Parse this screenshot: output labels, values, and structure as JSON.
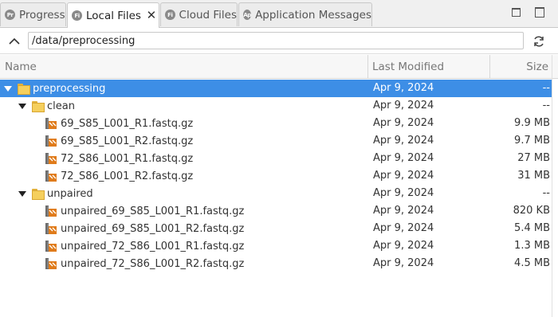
{
  "tabs": [
    {
      "label": "Progress",
      "icon": "Pr"
    },
    {
      "label": "Local Files",
      "icon": "Fi",
      "active": true
    },
    {
      "label": "Cloud Files",
      "icon": "Fi"
    },
    {
      "label": "Application Messages",
      "icon": "Ap"
    }
  ],
  "path": {
    "value": "/data/preprocessing"
  },
  "columns": {
    "name": "Name",
    "modified": "Last Modified",
    "size": "Size"
  },
  "rows": [
    {
      "name": "preprocessing",
      "modified": "Apr 9, 2024",
      "size": "--",
      "type": "folder",
      "selected": true
    },
    {
      "name": "clean",
      "modified": "Apr 9, 2024",
      "size": "--",
      "type": "folder"
    },
    {
      "name": "69_S85_L001_R1.fastq.gz",
      "modified": "Apr 9, 2024",
      "size": "9.9 MB",
      "type": "file"
    },
    {
      "name": "69_S85_L001_R2.fastq.gz",
      "modified": "Apr 9, 2024",
      "size": "9.7 MB",
      "type": "file"
    },
    {
      "name": "72_S86_L001_R1.fastq.gz",
      "modified": "Apr 9, 2024",
      "size": "27 MB",
      "type": "file"
    },
    {
      "name": "72_S86_L001_R2.fastq.gz",
      "modified": "Apr 9, 2024",
      "size": "31 MB",
      "type": "file"
    },
    {
      "name": "unpaired",
      "modified": "Apr 9, 2024",
      "size": "--",
      "type": "folder"
    },
    {
      "name": "unpaired_69_S85_L001_R1.fastq.gz",
      "modified": "Apr 9, 2024",
      "size": "820 KB",
      "type": "file"
    },
    {
      "name": "unpaired_69_S85_L001_R2.fastq.gz",
      "modified": "Apr 9, 2024",
      "size": "5.4 MB",
      "type": "file"
    },
    {
      "name": "unpaired_72_S86_L001_R1.fastq.gz",
      "modified": "Apr 9, 2024",
      "size": "1.3 MB",
      "type": "file"
    },
    {
      "name": "unpaired_72_S86_L001_R2.fastq.gz",
      "modified": "Apr 9, 2024",
      "size": "4.5 MB",
      "type": "file"
    }
  ],
  "colors": {
    "selection": "#3d8ee6",
    "folder": "#f5cf5d",
    "file_icon": "#e07b1a"
  }
}
